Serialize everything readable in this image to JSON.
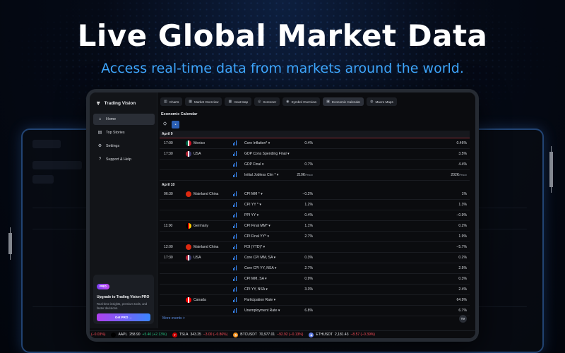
{
  "hero": {
    "title": "Live Global Market Data",
    "subtitle": "Access real-time data from markets around the world."
  },
  "app": {
    "name": "Trading Vision",
    "sidebar": [
      {
        "label": "Home",
        "icon": "home-icon",
        "glyph": "⌂",
        "active": true
      },
      {
        "label": "Top Stories",
        "icon": "newspaper-icon",
        "glyph": "▤",
        "active": false
      },
      {
        "label": "Settings",
        "icon": "gear-icon",
        "glyph": "⚙",
        "active": false
      },
      {
        "label": "Support & Help",
        "icon": "help-icon",
        "glyph": "?",
        "active": false
      }
    ],
    "promo": {
      "badge": "PRO",
      "title": "Upgrade to Trading Vision PRO",
      "description": "Real-time insights, premium tools, and faster decisions.",
      "button": "Get PRO →"
    },
    "tabs": [
      {
        "label": "Charts",
        "glyph": "▥",
        "active": false
      },
      {
        "label": "Market Overview",
        "glyph": "▦",
        "active": false
      },
      {
        "label": "Heat Map",
        "glyph": "▦",
        "active": false
      },
      {
        "label": "Screener",
        "glyph": "◎",
        "active": false
      },
      {
        "label": "Symbol Overview",
        "glyph": "◉",
        "active": false
      },
      {
        "label": "Economic Calendar",
        "glyph": "▣",
        "active": true
      },
      {
        "label": "Macro Maps",
        "glyph": "◍",
        "active": false
      }
    ],
    "calendar_title": "Economic Calendar",
    "date1": "April 9",
    "date2": "April 10",
    "more_events": "More events >",
    "fab": "TV"
  },
  "colors": {
    "accent": "#3a8bff",
    "positive": "#26c281",
    "negative": "#ff4d5a",
    "date_line": "#8a2b33"
  },
  "events": [
    {
      "time": "17:00",
      "country": "Mexico",
      "flag": [
        "#006847",
        "#ffffff",
        "#ce1126"
      ],
      "event": "Core Inflation* ▾",
      "actual": "0.4%",
      "prev": "0.46%",
      "strength": 3
    },
    {
      "time": "17:30",
      "country": "USA",
      "flag": [
        "#b22234",
        "#ffffff",
        "#3c3b6e"
      ],
      "event": "GDP Cons Spending Final ▾",
      "actual": "",
      "prev": "3.5%",
      "strength": 3
    },
    {
      "time": "",
      "country": "",
      "flag": null,
      "event": "GDP Final ▾",
      "actual": "0.7%",
      "prev": "4.4%",
      "strength": 3
    },
    {
      "time": "",
      "country": "",
      "flag": null,
      "event": "Initial Jobless Clm * ▾",
      "actual": "210K",
      "actual_unit": "Person",
      "prev": "202K",
      "prev_unit": "Person",
      "strength": 3
    },
    {
      "time": "06:30",
      "country": "Mainland China",
      "flag": [
        "#de2910",
        "#de2910",
        "#de2910"
      ],
      "event": "CPI MM * ▾",
      "actual": "−0.2%",
      "prev": "1%",
      "strength": 3
    },
    {
      "time": "",
      "country": "",
      "flag": null,
      "event": "CPI YY * ▾",
      "actual": "1.2%",
      "prev": "1.3%",
      "strength": 3
    },
    {
      "time": "",
      "country": "",
      "flag": null,
      "event": "PPI YY ▾",
      "actual": "0.4%",
      "prev": "−0.9%",
      "strength": 3
    },
    {
      "time": "11:00",
      "country": "Germany",
      "flag": [
        "#000000",
        "#dd0000",
        "#ffce00"
      ],
      "event": "CPI Final MM* ▾",
      "actual": "1.1%",
      "prev": "0.2%",
      "strength": 3
    },
    {
      "time": "",
      "country": "",
      "flag": null,
      "event": "CPI Final YY* ▾",
      "actual": "2.7%",
      "prev": "1.9%",
      "strength": 3
    },
    {
      "time": "12:00",
      "country": "Mainland China",
      "flag": [
        "#de2910",
        "#de2910",
        "#de2910"
      ],
      "event": "FDI (YTD)* ▾",
      "actual": "",
      "prev": "−5.7%",
      "strength": 3
    },
    {
      "time": "17:30",
      "country": "USA",
      "flag": [
        "#b22234",
        "#ffffff",
        "#3c3b6e"
      ],
      "event": "Core CPI MM, SA ▾",
      "actual": "0.3%",
      "prev": "0.2%",
      "strength": 3
    },
    {
      "time": "",
      "country": "",
      "flag": null,
      "event": "Core CPI YY, NSA ▾",
      "actual": "2.7%",
      "prev": "2.5%",
      "strength": 3
    },
    {
      "time": "",
      "country": "",
      "flag": null,
      "event": "CPI MM, SA ▾",
      "actual": "0.9%",
      "prev": "0.3%",
      "strength": 3
    },
    {
      "time": "",
      "country": "",
      "flag": null,
      "event": "CPI YY, NSA ▾",
      "actual": "3.3%",
      "prev": "2.4%",
      "strength": 3
    },
    {
      "time": "",
      "country": "Canada",
      "flag": [
        "#ff0000",
        "#ffffff",
        "#ff0000"
      ],
      "event": "Participation Rate ▾",
      "actual": "",
      "prev": "64.9%",
      "strength": 3
    },
    {
      "time": "",
      "country": "",
      "flag": null,
      "event": "Unemployment Rate ▾",
      "actual": "6.8%",
      "prev": "6.7%",
      "strength": 3
    }
  ],
  "ticker": [
    {
      "symbol": "",
      "price": "",
      "change": "(−0.03%)",
      "dir": "dn",
      "icon": ""
    },
    {
      "symbol": "AAPL",
      "price": "258.90",
      "change": "+5.40 (+2.13%)",
      "dir": "up",
      "icon": "apple-icon",
      "glyph": "",
      "bg": "#000000"
    },
    {
      "symbol": "TSLA",
      "price": "343.25",
      "change": "−3.00 (−0.86%)",
      "dir": "dn",
      "icon": "tesla-icon",
      "glyph": "T",
      "bg": "#cc0000"
    },
    {
      "symbol": "BTCUSDT",
      "price": "70,977.01",
      "change": "−92.92 (−0.13%)",
      "dir": "dn",
      "icon": "bitcoin-icon",
      "glyph": "₿",
      "bg": "#f7931a"
    },
    {
      "symbol": "ETHUSDT",
      "price": "2,181.43",
      "change": "−8.57 (−0.39%)",
      "dir": "dn",
      "icon": "ethereum-icon",
      "glyph": "◆",
      "bg": "#627eea"
    }
  ]
}
